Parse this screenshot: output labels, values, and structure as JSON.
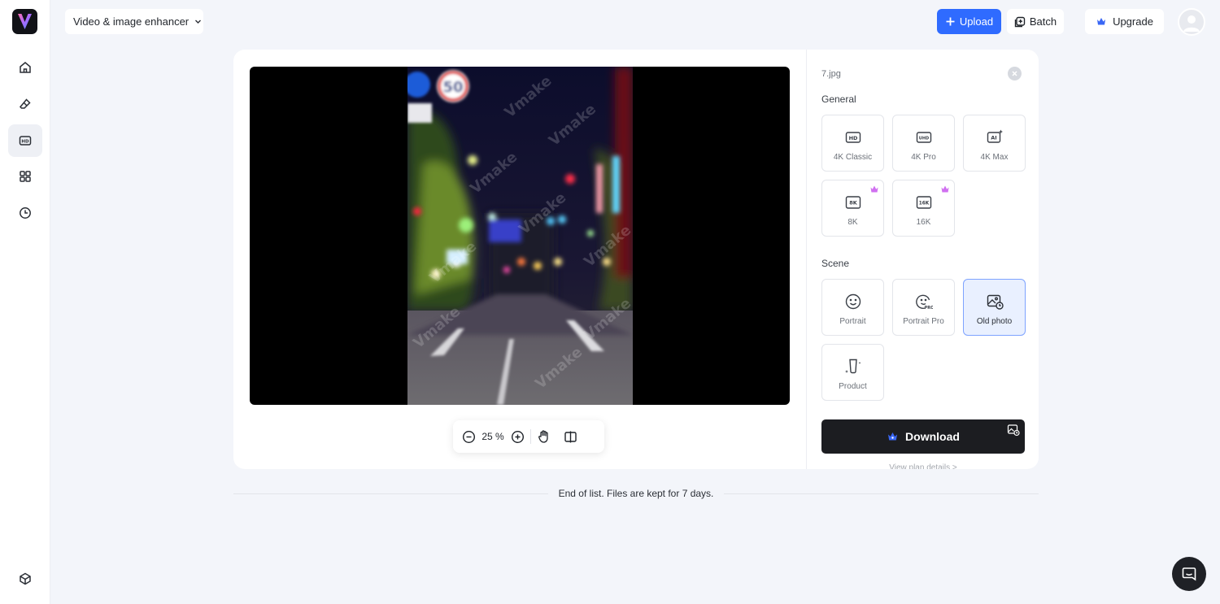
{
  "header": {
    "tool_select": "Video & image enhancer",
    "upload_label": "Upload",
    "batch_label": "Batch",
    "upgrade_label": "Upgrade"
  },
  "sidebar": {
    "items": [
      {
        "icon": "home-icon"
      },
      {
        "icon": "eraser-icon"
      },
      {
        "icon": "hd-icon",
        "active": true
      },
      {
        "icon": "apps-grid-icon"
      },
      {
        "icon": "history-clock-icon"
      }
    ],
    "bottom_icon": "cube-icon"
  },
  "preview": {
    "zoom": "25 %",
    "watermark": "Vmake"
  },
  "panel": {
    "filename": "7.jpg",
    "general_label": "General",
    "general_options": [
      {
        "label": "4K Classic",
        "icon": "hd-badge-icon",
        "pro": false
      },
      {
        "label": "4K Pro",
        "icon": "uhd-badge-icon",
        "pro": false
      },
      {
        "label": "4K Max",
        "icon": "ai-sparkle-icon",
        "pro": false
      },
      {
        "label": "8K",
        "icon": "8k-badge-icon",
        "pro": true
      },
      {
        "label": "16K",
        "icon": "16k-badge-icon",
        "pro": true
      }
    ],
    "scene_label": "Scene",
    "scene_options": [
      {
        "label": "Portrait",
        "icon": "smile-face-icon",
        "selected": false
      },
      {
        "label": "Portrait Pro",
        "icon": "smile-face-pro-icon",
        "selected": false
      },
      {
        "label": "Old photo",
        "icon": "old-photo-icon",
        "selected": true
      },
      {
        "label": "Product",
        "icon": "product-bottle-icon",
        "selected": false
      }
    ],
    "download_label": "Download",
    "plan_link": "View plan details >"
  },
  "footer": {
    "end_text": "End of list. Files are kept for 7 days."
  },
  "colors": {
    "accent": "#2f6bff",
    "pro_badge": "#d070f0",
    "download_bg": "#1c1d21",
    "selected_bg": "#e9f0ff"
  }
}
